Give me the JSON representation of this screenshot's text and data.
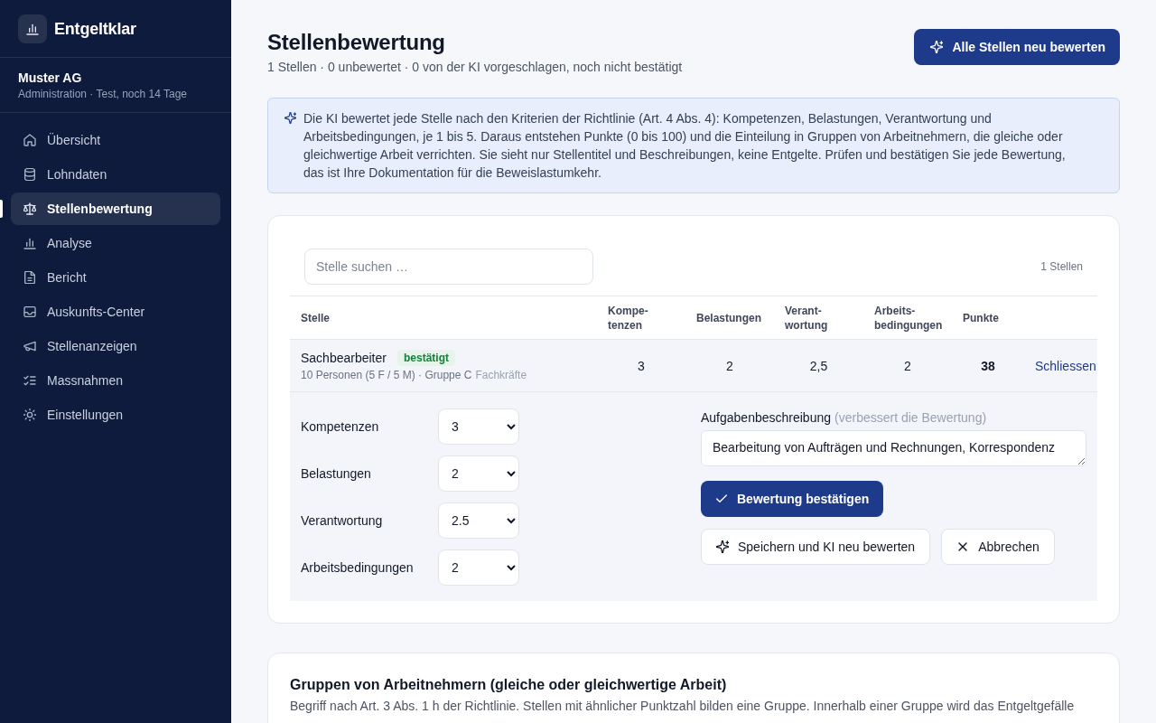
{
  "sidebar": {
    "brand": "Entgeltklar",
    "org": {
      "name": "Muster AG",
      "detail": "Administration · Test, noch 14 Tage"
    },
    "items": [
      {
        "label": "Übersicht",
        "selected": false
      },
      {
        "label": "Lohndaten",
        "selected": false
      },
      {
        "label": "Stellenbewertung",
        "selected": true
      },
      {
        "label": "Analyse",
        "selected": false
      },
      {
        "label": "Bericht",
        "selected": false
      },
      {
        "label": "Auskunfts-Center",
        "selected": false
      },
      {
        "label": "Stellenanzeigen",
        "selected": false
      },
      {
        "label": "Massnahmen",
        "selected": false
      },
      {
        "label": "Einstellungen",
        "selected": false
      }
    ]
  },
  "header": {
    "title": "Stellenbewertung",
    "subtitle": "1 Stellen · 0 unbewertet · 0 von der KI vorgeschlagen, noch nicht bestätigt",
    "action": "Alle Stellen neu bewerten"
  },
  "notice": {
    "text": "Die KI bewertet jede Stelle nach den Kriterien der Richtlinie (Art. 4 Abs. 4): Kompetenzen, Belastungen, Verantwortung und Arbeitsbedingungen, je 1 bis 5. Daraus entstehen Punkte (0 bis 100) und die Einteilung in Gruppen von Arbeitnehmern, die gleiche oder gleichwertige Arbeit verrichten. Sie sieht nur Stellentitel und Beschreibungen, keine Entgelte. Prüfen und bestätigen Sie jede Bewertung, das ist Ihre Dokumentation für die Beweislastumkehr."
  },
  "jobs": {
    "search": {
      "placeholder": "Stelle suchen …"
    },
    "count": "1 Stellen",
    "columns": [
      "Stelle",
      "Kompe-tenzen",
      "Belastungen",
      "Verant-wortung",
      "Arbeits-bedingungen",
      "Punkte"
    ],
    "rows": [
      {
        "title": "Sachbearbeiter",
        "status": "bestätigt",
        "meta": "10 Personen (5 F / 5 M) · Gruppe C",
        "group": "Fachkräfte",
        "scores": [
          "3",
          "2",
          "2,5",
          "2"
        ],
        "points": "38",
        "action": "Schliessen",
        "expanded": true,
        "editor": {
          "criteria": [
            {
              "label": "Kompetenzen",
              "value": "3"
            },
            {
              "label": "Belastungen",
              "value": "2"
            },
            {
              "label": "Verantwortung",
              "value": "2.5"
            },
            {
              "label": "Arbeitsbedingungen",
              "value": "2"
            }
          ],
          "description": {
            "label": "Aufgabenbeschreibung",
            "hint": "(verbessert die Bewertung)",
            "value": "Bearbeitung von Aufträgen und Rechnungen, Korrespondenz"
          },
          "buttons": [
            {
              "label": "Bewertung bestätigen",
              "kind": "confirm"
            },
            {
              "label": "Speichern und KI neu bewerten",
              "kind": "reassess"
            },
            {
              "label": "Abbrechen",
              "kind": "cancel"
            }
          ]
        }
      }
    ]
  },
  "groups": {
    "title": "Gruppen von Arbeitnehmern (gleiche oder gleichwertige Arbeit)",
    "text": "Begriff nach Art. 3 Abs. 1 h der Richtlinie. Stellen mit ähnlicher Punktzahl bilden eine Gruppe. Innerhalb einer Gruppe wird das Entgeltgefälle"
  }
}
